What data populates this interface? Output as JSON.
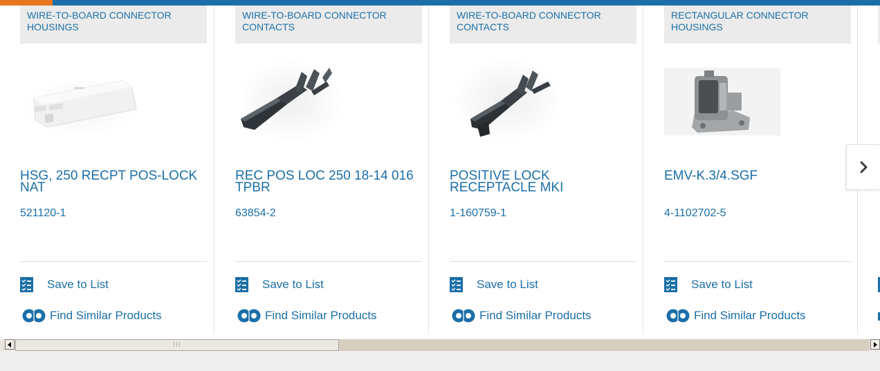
{
  "colors": {
    "link": "#1b6fa8",
    "accent": "#e8761c",
    "category_bg": "#ebebeb"
  },
  "products": [
    {
      "category": "WIRE-TO-BOARD CONNECTOR HOUSINGS",
      "title": "HSG, 250 RECPT POS-LOCK NAT",
      "part_number": "521120-1",
      "save_label": "Save to List",
      "similar_label": "Find Similar Products"
    },
    {
      "category": "WIRE-TO-BOARD CONNECTOR CONTACTS",
      "title": "REC POS LOC 250 18-14 016 TPBR",
      "part_number": "63854-2",
      "save_label": "Save to List",
      "similar_label": "Find Similar Products"
    },
    {
      "category": "WIRE-TO-BOARD CONNECTOR CONTACTS",
      "title": "POSITIVE LOCK RECEPTACLE MKI",
      "part_number": "1-160759-1",
      "save_label": "Save to List",
      "similar_label": "Find Similar Products"
    },
    {
      "category": "RECTANGULAR CONNECTOR HOUSINGS",
      "title": "EMV-K.3/4.SGF",
      "part_number": "4-1102702-5",
      "save_label": "Save to List",
      "similar_label": "Find Similar Products"
    }
  ],
  "icons": {
    "next": "chevron-right-icon",
    "save": "checklist-icon",
    "similar": "gears-icon"
  },
  "scrollbar": {
    "thumb_fraction": 0.37
  }
}
